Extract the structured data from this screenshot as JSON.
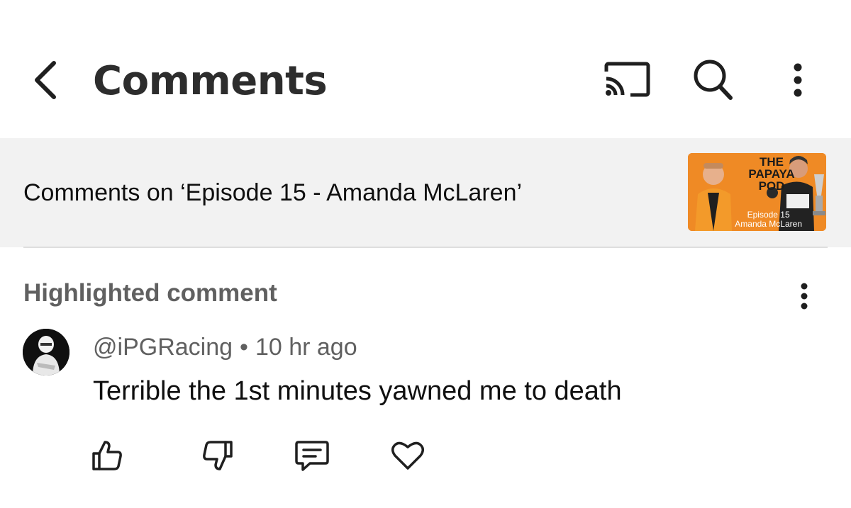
{
  "header": {
    "title": "Comments",
    "icons": {
      "back": "chevron-left-icon",
      "cast": "cast-icon",
      "search": "search-icon",
      "more": "more-vertical-icon"
    }
  },
  "context": {
    "text": "Comments on ‘Episode 15 - Amanda McLaren’",
    "thumbnail": {
      "title_line1": "THE",
      "title_line2": "PAPAYA",
      "title_line3": "POD",
      "subtitle_line1": "Episode 15",
      "subtitle_line2": "Amanda McLaren",
      "background_color": "#ef8a25"
    }
  },
  "highlighted": {
    "label": "Highlighted comment",
    "author": "@iPGRacing",
    "separator": "•",
    "time": "10 hr ago",
    "text": "Terrible the 1st minutes yawned me to death",
    "actions": [
      "thumbs-up-icon",
      "thumbs-down-icon",
      "reply-icon",
      "heart-icon"
    ]
  }
}
